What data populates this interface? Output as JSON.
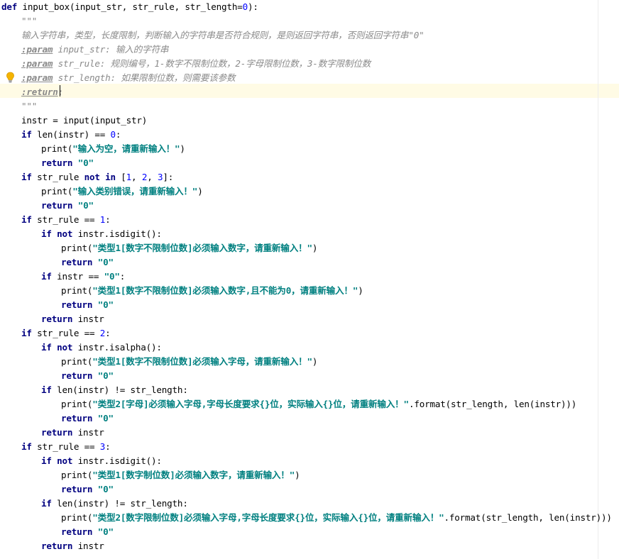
{
  "editor": {
    "lines": [
      {
        "indent": 0,
        "parts": [
          {
            "c": "kw",
            "t": "def"
          },
          {
            "c": "",
            "t": " input_box(input_str, str_rule, str_length="
          },
          {
            "c": "num",
            "t": "0"
          },
          {
            "c": "",
            "t": "):"
          }
        ]
      },
      {
        "indent": 1,
        "parts": [
          {
            "c": "doc",
            "t": "\"\"\""
          }
        ]
      },
      {
        "indent": 1,
        "parts": [
          {
            "c": "doc",
            "t": "输入字符串，类型，长度限制，判断输入的字符串是否符合规则，是则返回字符串，否则返回字符串\"0\""
          }
        ]
      },
      {
        "indent": 1,
        "parts": [
          {
            "c": "doc-tag",
            "t": ":param"
          },
          {
            "c": "doc-param",
            "t": " input_str"
          },
          {
            "c": "doc",
            "t": ": 输入的字符串"
          }
        ]
      },
      {
        "indent": 1,
        "parts": [
          {
            "c": "doc-tag",
            "t": ":param"
          },
          {
            "c": "doc-param",
            "t": " str_rule"
          },
          {
            "c": "doc",
            "t": ": 规则编号，1-数字不限制位数，2-字母限制位数，3-数字限制位数"
          }
        ]
      },
      {
        "indent": 1,
        "parts": [
          {
            "c": "doc-tag",
            "t": ":param"
          },
          {
            "c": "doc-param",
            "t": " str_length"
          },
          {
            "c": "doc",
            "t": ": 如果限制位数，则需要该参数"
          }
        ]
      },
      {
        "indent": 1,
        "parts": [
          {
            "c": "doc-tag",
            "t": ":return"
          },
          {
            "c": "doc",
            "t": ":"
          }
        ]
      },
      {
        "indent": 1,
        "parts": [
          {
            "c": "doc",
            "t": "\"\"\""
          }
        ]
      },
      {
        "indent": 1,
        "parts": [
          {
            "c": "",
            "t": "instr = input(input_str)"
          }
        ]
      },
      {
        "indent": 1,
        "parts": [
          {
            "c": "kw",
            "t": "if"
          },
          {
            "c": "",
            "t": " len(instr) == "
          },
          {
            "c": "num",
            "t": "0"
          },
          {
            "c": "",
            "t": ":"
          }
        ]
      },
      {
        "indent": 2,
        "parts": [
          {
            "c": "",
            "t": "print("
          },
          {
            "c": "str",
            "t": "\"输入为空，请重新输入！\""
          },
          {
            "c": "",
            "t": ")"
          }
        ]
      },
      {
        "indent": 2,
        "parts": [
          {
            "c": "kw",
            "t": "return"
          },
          {
            "c": "",
            "t": " "
          },
          {
            "c": "str",
            "t": "\"0\""
          }
        ]
      },
      {
        "indent": 1,
        "parts": [
          {
            "c": "kw",
            "t": "if"
          },
          {
            "c": "",
            "t": " str_rule "
          },
          {
            "c": "kw",
            "t": "not in"
          },
          {
            "c": "",
            "t": " ["
          },
          {
            "c": "num",
            "t": "1"
          },
          {
            "c": "",
            "t": ", "
          },
          {
            "c": "num",
            "t": "2"
          },
          {
            "c": "",
            "t": ", "
          },
          {
            "c": "num",
            "t": "3"
          },
          {
            "c": "",
            "t": "]:"
          }
        ]
      },
      {
        "indent": 2,
        "parts": [
          {
            "c": "",
            "t": "print("
          },
          {
            "c": "str",
            "t": "\"输入类别错误，请重新输入！\""
          },
          {
            "c": "",
            "t": ")"
          }
        ]
      },
      {
        "indent": 2,
        "parts": [
          {
            "c": "kw",
            "t": "return"
          },
          {
            "c": "",
            "t": " "
          },
          {
            "c": "str",
            "t": "\"0\""
          }
        ]
      },
      {
        "indent": 1,
        "parts": [
          {
            "c": "kw",
            "t": "if"
          },
          {
            "c": "",
            "t": " str_rule == "
          },
          {
            "c": "num",
            "t": "1"
          },
          {
            "c": "",
            "t": ":"
          }
        ]
      },
      {
        "indent": 2,
        "parts": [
          {
            "c": "kw",
            "t": "if not"
          },
          {
            "c": "",
            "t": " instr.isdigit():"
          }
        ]
      },
      {
        "indent": 3,
        "parts": [
          {
            "c": "",
            "t": "print("
          },
          {
            "c": "str",
            "t": "\"类型1[数字不限制位数]必须输入数字，请重新输入！\""
          },
          {
            "c": "",
            "t": ")"
          }
        ]
      },
      {
        "indent": 3,
        "parts": [
          {
            "c": "kw",
            "t": "return"
          },
          {
            "c": "",
            "t": " "
          },
          {
            "c": "str",
            "t": "\"0\""
          }
        ]
      },
      {
        "indent": 2,
        "parts": [
          {
            "c": "kw",
            "t": "if"
          },
          {
            "c": "",
            "t": " instr == "
          },
          {
            "c": "str",
            "t": "\"0\""
          },
          {
            "c": "",
            "t": ":"
          }
        ]
      },
      {
        "indent": 3,
        "parts": [
          {
            "c": "",
            "t": "print("
          },
          {
            "c": "str",
            "t": "\"类型1[数字不限制位数]必须输入数字,且不能为0，请重新输入！\""
          },
          {
            "c": "",
            "t": ")"
          }
        ]
      },
      {
        "indent": 3,
        "parts": [
          {
            "c": "kw",
            "t": "return"
          },
          {
            "c": "",
            "t": " "
          },
          {
            "c": "str",
            "t": "\"0\""
          }
        ]
      },
      {
        "indent": 2,
        "parts": [
          {
            "c": "kw",
            "t": "return"
          },
          {
            "c": "",
            "t": " instr"
          }
        ]
      },
      {
        "indent": 1,
        "parts": [
          {
            "c": "kw",
            "t": "if"
          },
          {
            "c": "",
            "t": " str_rule == "
          },
          {
            "c": "num",
            "t": "2"
          },
          {
            "c": "",
            "t": ":"
          }
        ]
      },
      {
        "indent": 2,
        "parts": [
          {
            "c": "kw",
            "t": "if not"
          },
          {
            "c": "",
            "t": " instr.isalpha():"
          }
        ]
      },
      {
        "indent": 3,
        "parts": [
          {
            "c": "",
            "t": "print("
          },
          {
            "c": "str",
            "t": "\"类型1[数字不限制位数]必须输入字母，请重新输入！\""
          },
          {
            "c": "",
            "t": ")"
          }
        ]
      },
      {
        "indent": 3,
        "parts": [
          {
            "c": "kw",
            "t": "return"
          },
          {
            "c": "",
            "t": " "
          },
          {
            "c": "str",
            "t": "\"0\""
          }
        ]
      },
      {
        "indent": 2,
        "parts": [
          {
            "c": "kw",
            "t": "if"
          },
          {
            "c": "",
            "t": " len(instr) != str_length:"
          }
        ]
      },
      {
        "indent": 3,
        "parts": [
          {
            "c": "",
            "t": "print("
          },
          {
            "c": "str",
            "t": "\"类型2[字母]必须输入字母,字母长度要求{}位，实际输入{}位，请重新输入！\""
          },
          {
            "c": "",
            "t": ".format(str_length, len(instr)))"
          }
        ]
      },
      {
        "indent": 3,
        "parts": [
          {
            "c": "kw",
            "t": "return"
          },
          {
            "c": "",
            "t": " "
          },
          {
            "c": "str",
            "t": "\"0\""
          }
        ]
      },
      {
        "indent": 2,
        "parts": [
          {
            "c": "kw",
            "t": "return"
          },
          {
            "c": "",
            "t": " instr"
          }
        ]
      },
      {
        "indent": 1,
        "parts": [
          {
            "c": "kw",
            "t": "if"
          },
          {
            "c": "",
            "t": " str_rule == "
          },
          {
            "c": "num",
            "t": "3"
          },
          {
            "c": "",
            "t": ":"
          }
        ]
      },
      {
        "indent": 2,
        "parts": [
          {
            "c": "kw",
            "t": "if not"
          },
          {
            "c": "",
            "t": " instr.isdigit():"
          }
        ]
      },
      {
        "indent": 3,
        "parts": [
          {
            "c": "",
            "t": "print("
          },
          {
            "c": "str",
            "t": "\"类型1[数字制位数]必须输入数字，请重新输入！\""
          },
          {
            "c": "",
            "t": ")"
          }
        ]
      },
      {
        "indent": 3,
        "parts": [
          {
            "c": "kw",
            "t": "return"
          },
          {
            "c": "",
            "t": " "
          },
          {
            "c": "str",
            "t": "\"0\""
          }
        ]
      },
      {
        "indent": 2,
        "parts": [
          {
            "c": "kw",
            "t": "if"
          },
          {
            "c": "",
            "t": " len(instr) != str_length:"
          }
        ]
      },
      {
        "indent": 3,
        "parts": [
          {
            "c": "",
            "t": "print("
          },
          {
            "c": "str",
            "t": "\"类型2[数字限制位数]必须输入字母,字母长度要求{}位，实际输入{}位，请重新输入！\""
          },
          {
            "c": "",
            "t": ".format(str_length, len(instr)))"
          }
        ]
      },
      {
        "indent": 3,
        "parts": [
          {
            "c": "kw",
            "t": "return"
          },
          {
            "c": "",
            "t": " "
          },
          {
            "c": "str",
            "t": "\"0\""
          }
        ]
      },
      {
        "indent": 2,
        "parts": [
          {
            "c": "kw",
            "t": "return"
          },
          {
            "c": "",
            "t": " instr"
          }
        ]
      }
    ]
  },
  "icons": {
    "intention": "lightbulb-icon"
  },
  "colors": {
    "keyword": "#000080",
    "number": "#0000ff",
    "string": "#008080",
    "docstring": "#8a8a8a",
    "caret_row": "#fffbe5"
  }
}
